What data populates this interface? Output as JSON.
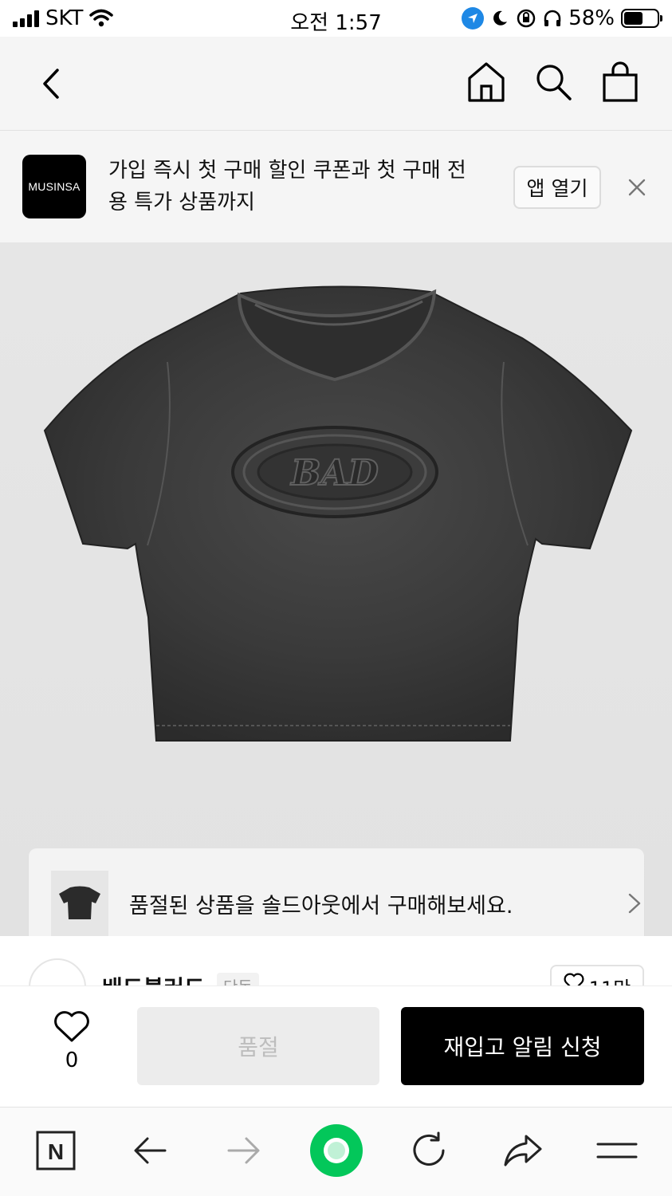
{
  "status_bar": {
    "carrier": "SKT",
    "time": "오전 1:57",
    "battery": "58%",
    "battery_level": 0.58
  },
  "header": {
    "icons": [
      "back-icon",
      "home-icon",
      "search-icon",
      "shopping-bag-icon"
    ]
  },
  "app_banner": {
    "logo_text": "MUSINSA",
    "message": "가입 즉시 첫 구매 할인 쿠폰과 첫 구매 전용 특가 상품까지",
    "open_button": "앱 열기"
  },
  "product": {
    "print_text": "BAD"
  },
  "soldout_card": {
    "message": "품절된 상품을 솔드아웃에서 구매해보세요."
  },
  "brand_row": {
    "name": "배드블러드",
    "tag": "단독",
    "likes": "11만"
  },
  "purchase_bar": {
    "like_count": "0",
    "soldout_label": "품절",
    "restock_label": "재입고 알림 신청"
  },
  "browser_toolbar": {
    "home_letter": "N",
    "colors": {
      "accent_green": "#03c75a"
    }
  }
}
